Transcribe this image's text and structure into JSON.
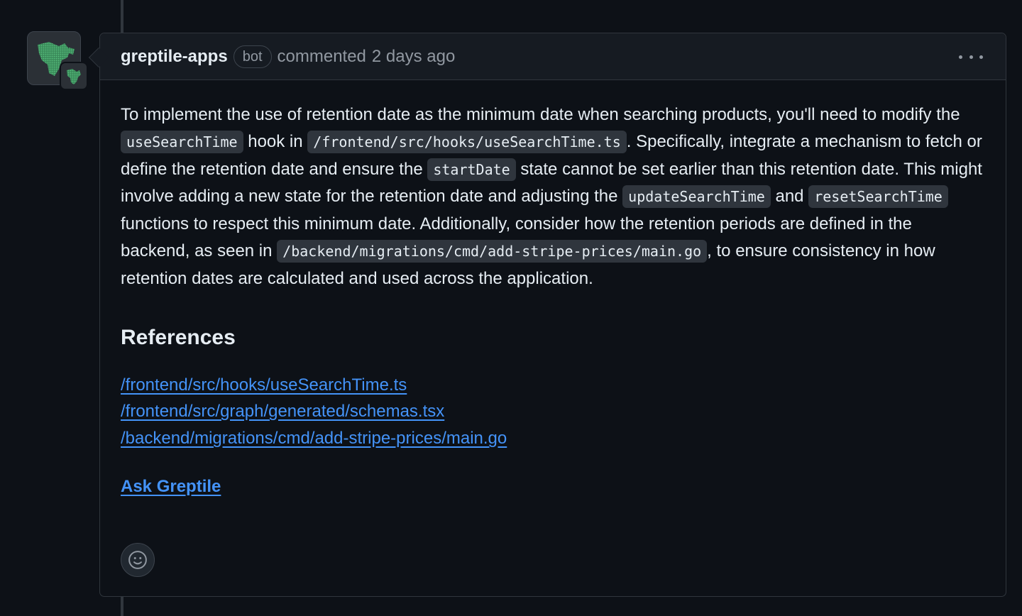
{
  "comment": {
    "author": "greptile-apps",
    "badge": "bot",
    "action": "commented",
    "timestamp": "2 days ago",
    "menu_icon": "kebab-horizontal-icon",
    "body": {
      "seg1": "To implement the use of retention date as the minimum date when searching products, you'll need to modify the ",
      "code1": "useSearchTime",
      "seg2": " hook in ",
      "code2": "/frontend/src/hooks/useSearchTime.ts",
      "seg3": ". Specifically, integrate a mechanism to fetch or define the retention date and ensure the ",
      "code3": "startDate",
      "seg4": " state cannot be set earlier than this retention date. This might involve adding a new state for the retention date and adjusting the ",
      "code4": "updateSearchTime",
      "seg5": " and ",
      "code5": "resetSearchTime",
      "seg6": " functions to respect this minimum date. Additionally, consider how the retention periods are defined in the backend, as seen in ",
      "code6": "/backend/migrations/cmd/add-stripe-prices/main.go",
      "seg7": ", to ensure consistency in how retention dates are calculated and used across the application."
    },
    "references_heading": "References",
    "references": [
      "/frontend/src/hooks/useSearchTime.ts",
      "/frontend/src/graph/generated/schemas.tsx",
      "/backend/migrations/cmd/add-stripe-prices/main.go"
    ],
    "ask_link": "Ask Greptile",
    "reaction_icon": "smiley-icon"
  },
  "colors": {
    "background": "#0d1117",
    "header_bg": "#161b22",
    "border": "#30363d",
    "text": "#e6edf3",
    "muted": "#9198a1",
    "link": "#4493f8",
    "code_bg": "#2f353d",
    "avatar_green": "#3fb950"
  }
}
